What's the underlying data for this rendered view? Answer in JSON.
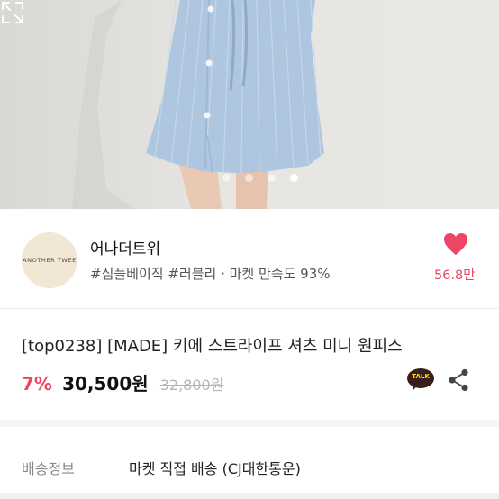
{
  "gallery": {
    "total_images": 4,
    "active_index": 3,
    "expand_icon": "expand-icon"
  },
  "seller": {
    "avatar_text": "ANOTHER TWEE",
    "name": "어나더트위",
    "tags": "#심플베이직 #러블리 · 마켓 만족도 93%",
    "like_count": "56.8만",
    "like_icon": "heart-icon"
  },
  "product": {
    "title": "[top0238] [MADE] 키에 스트라이프 셔츠 미니 원피스",
    "discount": "7%",
    "price": "30,500원",
    "original_price": "32,800원",
    "talk_label": "TALK",
    "share_icon": "share-icon"
  },
  "shipping": {
    "label": "배송정보",
    "value": "마켓 직접 배송 (CJ대한통운)"
  },
  "colors": {
    "accent": "#ef4565",
    "talk_bg": "#3a1d1d",
    "talk_text": "#f7e600",
    "dress": "#aec6e0"
  }
}
